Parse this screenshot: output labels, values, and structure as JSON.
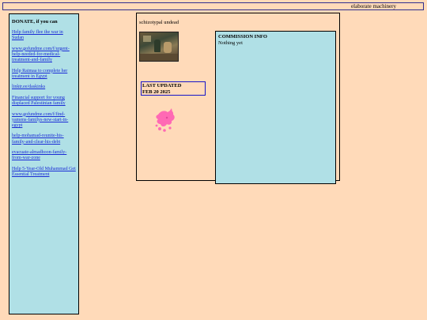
{
  "header": {
    "title": "elaborate machinery"
  },
  "donate": {
    "heading": "DONATE, if you can",
    "links": [
      "Help family flee the war in Sudan",
      "www.gofundme.com/f/urgent-help-needed-for-medical-treatment-and-family",
      "Help Raimaa to complete her treatment in Egypt",
      "linktr.ee/daskinks",
      "Financial support for young displaced Palestinian family",
      "www.gofundme.com/f/find-yamens-familys-new-start-in-egypt",
      "help-mohamad-reunite-his-family-and-clear-his-debt",
      "evacuate-almadhoon-family-from-war-zone",
      "Help 5-Year-Old Muhammad Get Essential Treatment"
    ]
  },
  "profile": {
    "name": "schizotypal undead",
    "last_updated_label": "LAST UPDATED",
    "last_updated_date": "FEB 20 2025"
  },
  "commission": {
    "title": "COMMISSION INFO",
    "body": "Nothing yet"
  },
  "colors": {
    "background": "#ffdab9",
    "panel": "#b0e0e6",
    "link": "#1a2bd6",
    "accent_border": "#1515c8",
    "blob": "#ff69b4"
  }
}
